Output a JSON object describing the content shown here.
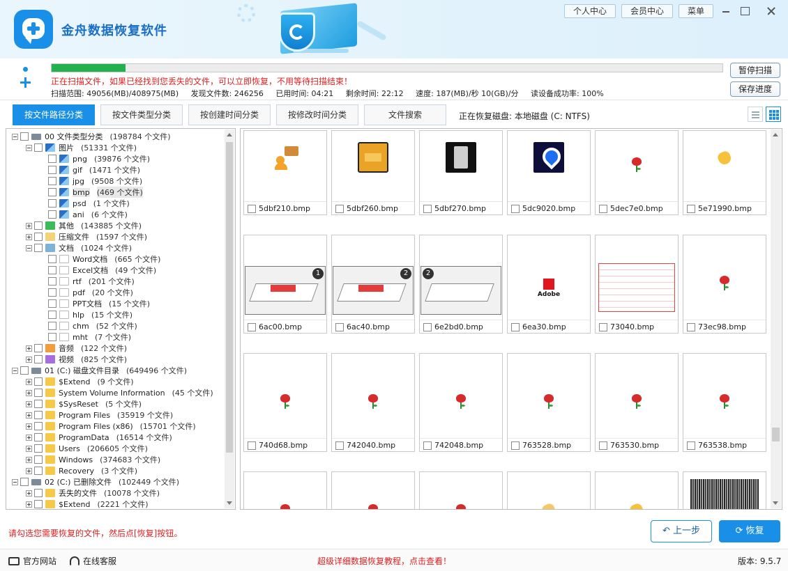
{
  "app": {
    "title": "金舟数据恢复软件"
  },
  "top_buttons": [
    "个人中心",
    "会员中心",
    "菜单"
  ],
  "scan": {
    "progress": 0.11,
    "message": "正在扫描文件，如果已经找到您丢失的文件，可以立即恢复，不用等待扫描结束！",
    "range": "扫描范围: 49056(MB)/408975(MB)",
    "found": "发现文件数: 246256",
    "elapsed": "已用时间: 04:21",
    "remaining": "剩余时间: 22:12",
    "speed": "速度: 187(MB)/秒  10(GB)/分",
    "success": "读设备成功率: 100%",
    "pause_label": "暂停扫描",
    "save_label": "保存进度"
  },
  "tabs": [
    "按文件路径分类",
    "按文件类型分类",
    "按创建时间分类",
    "按修改时间分类",
    "文件搜索"
  ],
  "disk_info": "正在恢复磁盘: 本地磁盘 (C: NTFS)",
  "tree": [
    {
      "label": "00 文件类型分类",
      "count": "(198784 个文件)"
    },
    {
      "label": "图片",
      "count": "(51331 个文件)"
    },
    {
      "label": "png",
      "count": "(39876 个文件)"
    },
    {
      "label": "gif",
      "count": "(1471 个文件)"
    },
    {
      "label": "jpg",
      "count": "(9508 个文件)"
    },
    {
      "label": "bmp",
      "count": "(469 个文件)"
    },
    {
      "label": "psd",
      "count": "(1 个文件)"
    },
    {
      "label": "ani",
      "count": "(6 个文件)"
    },
    {
      "label": "其他",
      "count": "(143885 个文件)"
    },
    {
      "label": "压缩文件",
      "count": "(1597 个文件)"
    },
    {
      "label": "文档",
      "count": "(1024 个文件)"
    },
    {
      "label": "Word文档",
      "count": "(665 个文件)"
    },
    {
      "label": "Excel文档",
      "count": "(49 个文件)"
    },
    {
      "label": "rtf",
      "count": "(201 个文件)"
    },
    {
      "label": "pdf",
      "count": "(20 个文件)"
    },
    {
      "label": "PPT文档",
      "count": "(15 个文件)"
    },
    {
      "label": "hlp",
      "count": "(15 个文件)"
    },
    {
      "label": "chm",
      "count": "(52 个文件)"
    },
    {
      "label": "mht",
      "count": "(7 个文件)"
    },
    {
      "label": "音频",
      "count": "(122 个文件)"
    },
    {
      "label": "视频",
      "count": "(825 个文件)"
    },
    {
      "label": "01 (C:) 磁盘文件目录",
      "count": "(649496 个文件)"
    },
    {
      "label": "$Extend",
      "count": "(9 个文件)"
    },
    {
      "label": "System Volume Information",
      "count": "(45 个文件)"
    },
    {
      "label": "$SysReset",
      "count": "(5 个文件)"
    },
    {
      "label": "Program Files",
      "count": "(35919 个文件)"
    },
    {
      "label": "Program Files (x86)",
      "count": "(15701 个文件)"
    },
    {
      "label": "ProgramData",
      "count": "(16514 个文件)"
    },
    {
      "label": "Users",
      "count": "(206605 个文件)"
    },
    {
      "label": "Windows",
      "count": "(374683 个文件)"
    },
    {
      "label": "Recovery",
      "count": "(3 个文件)"
    },
    {
      "label": "02 (C:) 已删除文件",
      "count": "(102449 个文件)"
    },
    {
      "label": "丢失的文件",
      "count": "(10078 个文件)"
    },
    {
      "label": "$Extend",
      "count": "(2221 个文件)"
    }
  ],
  "files": [
    "5dbf210.bmp",
    "5dbf260.bmp",
    "5dbf270.bmp",
    "5dc9020.bmp",
    "5dec7e0.bmp",
    "5e71990.bmp",
    "6ac00.bmp",
    "6ac40.bmp",
    "6e2bd0.bmp",
    "6ea30.bmp",
    "73040.bmp",
    "73ec98.bmp",
    "740d68.bmp",
    "742040.bmp",
    "742048.bmp",
    "763528.bmp",
    "763530.bmp",
    "763538.bmp"
  ],
  "thumb_text": {
    "adobe": "Adobe",
    "step1": "1",
    "step2": "2"
  },
  "footer": {
    "hint": "请勾选您需要恢复的文件，然后点[恢复]按钮。",
    "back_label": "上一步",
    "recover_label": "恢复",
    "website": "官方网站",
    "support": "在线客服",
    "tutorial": "超级详细数据恢复教程，点击查看！",
    "version": "版本: 9.5.7"
  },
  "colors": {
    "accent": "#1a8fe8",
    "warning": "#e02020",
    "progress": "#22b14c"
  }
}
